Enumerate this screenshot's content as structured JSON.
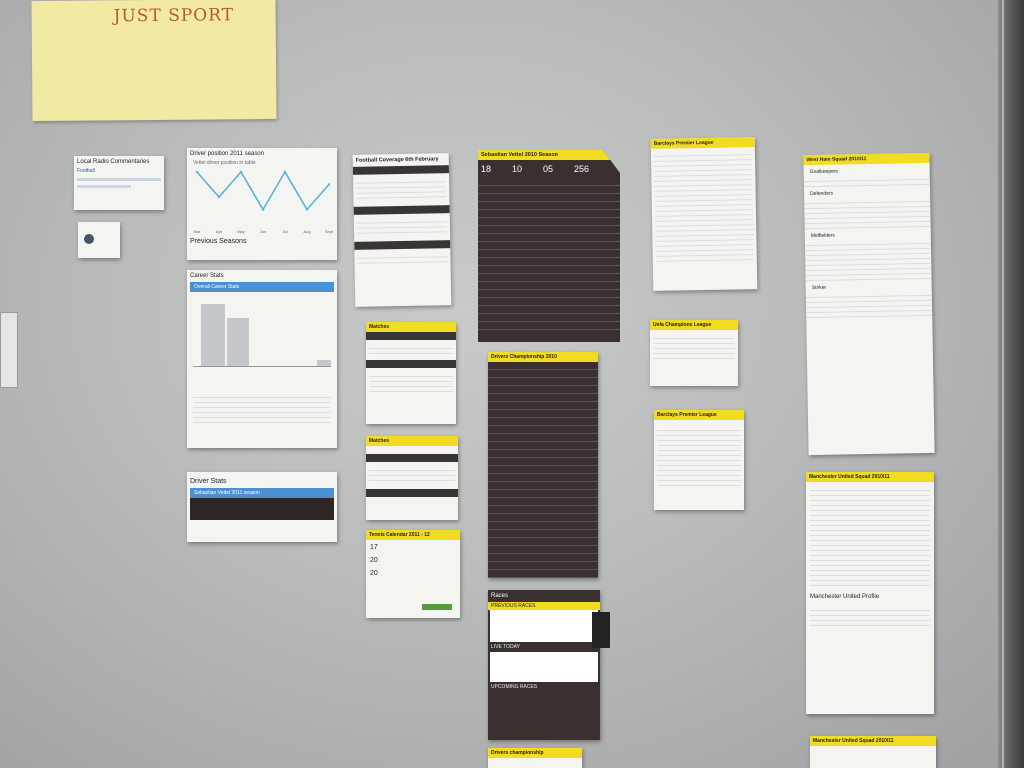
{
  "sticky_note": {
    "text": "JUST SPORT"
  },
  "cards": {
    "local_radio": {
      "title": "Local Radio Commentaries",
      "line1": "Football"
    },
    "driver_position": {
      "title": "Driver position 2011 season",
      "subtitle": "Vettel driver position in table",
      "section": "Previous Seasons"
    },
    "career_stats": {
      "title": "Career Stats",
      "bar_title": "Overall Career Stats"
    },
    "driver_stats": {
      "title": "Driver Stats",
      "bar_title": "Sebastian Vettel 2011 season"
    },
    "football_coverage": {
      "title": "Football Coverage 6th February"
    },
    "vettel_season": {
      "title": "Sebastian Vettel 2010 Season",
      "stats": [
        "18",
        "10",
        "05",
        "256"
      ]
    },
    "barclays_premier": {
      "title": "Barclays Premier League"
    },
    "west_ham": {
      "title": "West Ham Squad 2010/11",
      "sections": [
        "Goalkeepers",
        "Defenders",
        "Midfielders",
        "Striker"
      ]
    },
    "matches": {
      "title": "Matches"
    },
    "matches2": {
      "title": "Matches"
    },
    "tennis_calendar": {
      "title": "Tennis Calendar 2011 - 12",
      "dates": [
        "17",
        "20",
        "20"
      ]
    },
    "drivers_championship": {
      "title": "Drivers Championship 2010"
    },
    "uefa_champions": {
      "title": "Uefa Champions League"
    },
    "barclays_premier_2": {
      "title": "Barclays Premier League"
    },
    "man_utd": {
      "title": "Manchester United Squad 2010/11",
      "profile": "Manchester United Profile"
    },
    "races": {
      "title": "Races",
      "previous": "PREVIOUS RACES",
      "live": "LIVE TODAY",
      "upcoming": "UPCOMING RACES"
    },
    "drivers_championship_2": {
      "title": "Drivers championship"
    },
    "man_utd_2": {
      "title": "Manchester United Squad 2010/11"
    }
  },
  "chart_data": {
    "type": "line",
    "title": "Driver position 2011 season",
    "x": [
      "Mar",
      "Apr",
      "May",
      "Jun",
      "Jul",
      "Aug",
      "Sept"
    ],
    "series": [
      {
        "values": [
          1,
          3,
          1,
          4,
          1,
          4,
          2
        ]
      }
    ],
    "ylim": [
      1,
      5
    ]
  },
  "colors": {
    "accent": "#f2dc22",
    "dark_panel": "#3b3030",
    "wall": "#bfc1c1",
    "sticky": "#f2e9a2"
  }
}
